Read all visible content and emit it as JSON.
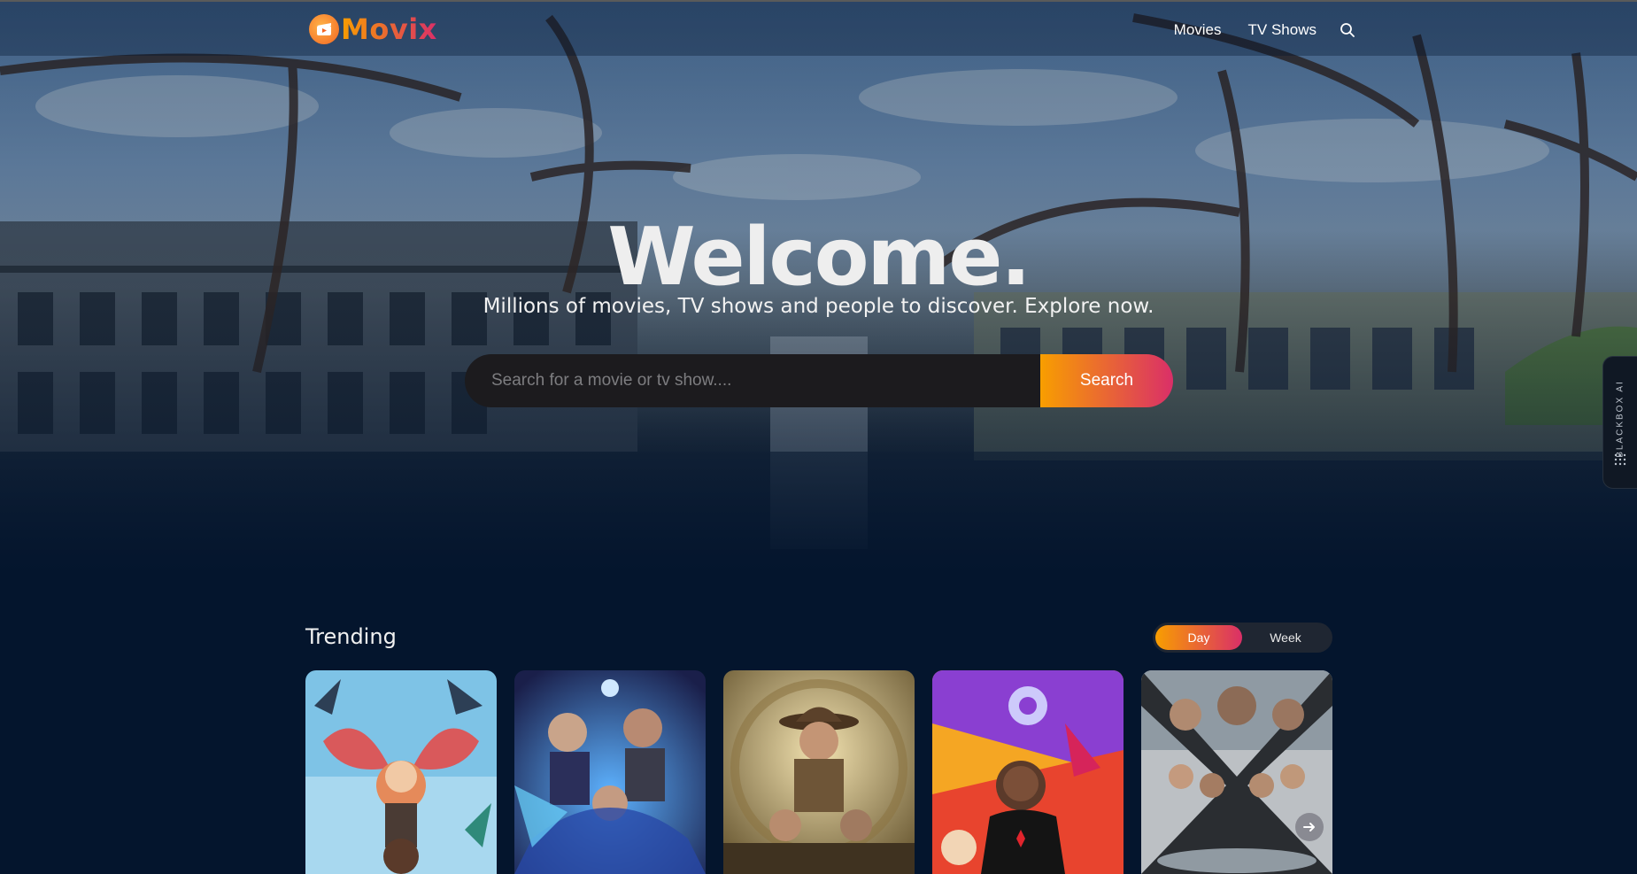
{
  "header": {
    "logo_text": "Movix",
    "nav": [
      "Movies",
      "TV Shows"
    ],
    "icons": {
      "logo": "clapperboard-icon",
      "search": "search-icon"
    }
  },
  "hero": {
    "title": "Welcome.",
    "subtitle": "Millions of movies, TV shows and people to discover. Explore now.",
    "search_placeholder": "Search for a movie or tv show....",
    "search_button": "Search"
  },
  "side_widget": {
    "label": "BLACKBOX AI",
    "icon": "dots-grid-icon"
  },
  "trending": {
    "title": "Trending",
    "tabs": [
      "Day",
      "Week"
    ],
    "active_tab": "Day",
    "cards": [
      {
        "poster": "animated-dragon-wings-poster"
      },
      {
        "poster": "fantasy-heroes-blue-poster"
      },
      {
        "poster": "adventure-hat-poster"
      },
      {
        "poster": "animated-spider-hero-poster"
      },
      {
        "poster": "action-ensemble-cast-poster"
      }
    ],
    "carousel_arrow_icon": "arrow-right-icon"
  },
  "colors": {
    "background": "#04152d",
    "accent_start": "#f89e00",
    "accent_end": "#da2f68",
    "search_bg": "#1c1b1e"
  }
}
